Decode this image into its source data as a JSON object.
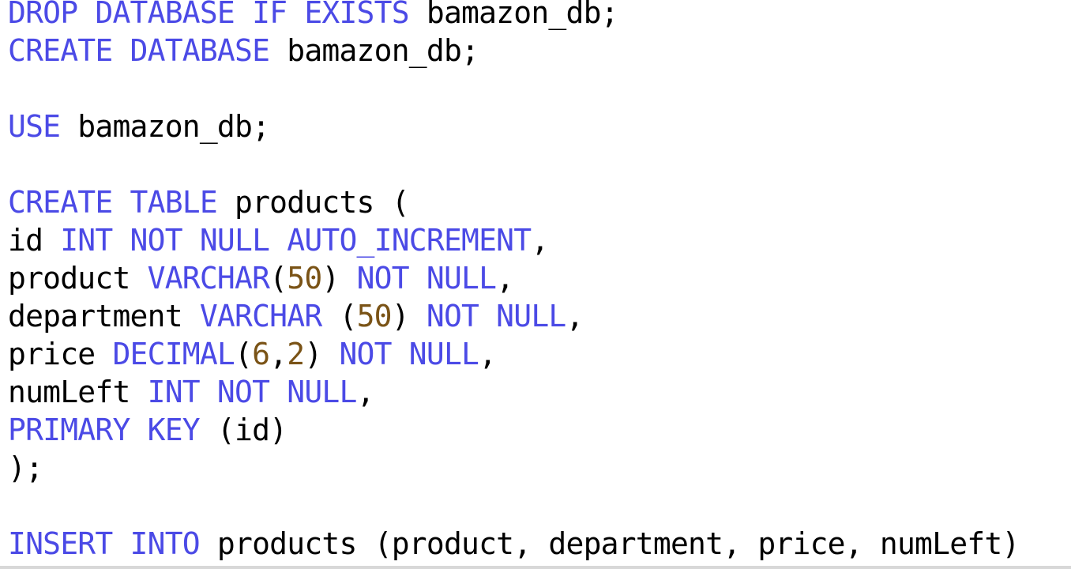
{
  "editor": {
    "colors": {
      "keyword": "#4b4ae6",
      "number": "#7a5316",
      "text": "#000000",
      "background": "#ffffff"
    },
    "lines": [
      [
        {
          "t": "DROP DATABASE IF EXISTS",
          "k": "kw"
        },
        {
          "t": " bamazon_db;",
          "k": "plain"
        }
      ],
      [
        {
          "t": "CREATE DATABASE",
          "k": "kw"
        },
        {
          "t": " bamazon_db;",
          "k": "plain"
        }
      ],
      [],
      [
        {
          "t": "USE",
          "k": "kw"
        },
        {
          "t": " bamazon_db;",
          "k": "plain"
        }
      ],
      [],
      [
        {
          "t": "CREATE TABLE",
          "k": "kw"
        },
        {
          "t": " products (",
          "k": "plain"
        }
      ],
      [
        {
          "t": "id ",
          "k": "plain"
        },
        {
          "t": "INT NOT NULL AUTO_INCREMENT",
          "k": "kw"
        },
        {
          "t": ",",
          "k": "plain"
        }
      ],
      [
        {
          "t": "product ",
          "k": "plain"
        },
        {
          "t": "VARCHAR",
          "k": "kw"
        },
        {
          "t": "(",
          "k": "plain"
        },
        {
          "t": "50",
          "k": "num"
        },
        {
          "t": ") ",
          "k": "plain"
        },
        {
          "t": "NOT NULL",
          "k": "kw"
        },
        {
          "t": ",",
          "k": "plain"
        }
      ],
      [
        {
          "t": "department ",
          "k": "plain"
        },
        {
          "t": "VARCHAR",
          "k": "kw"
        },
        {
          "t": " (",
          "k": "plain"
        },
        {
          "t": "50",
          "k": "num"
        },
        {
          "t": ") ",
          "k": "plain"
        },
        {
          "t": "NOT NULL",
          "k": "kw"
        },
        {
          "t": ",",
          "k": "plain"
        }
      ],
      [
        {
          "t": "price ",
          "k": "plain"
        },
        {
          "t": "DECIMAL",
          "k": "kw"
        },
        {
          "t": "(",
          "k": "plain"
        },
        {
          "t": "6",
          "k": "num"
        },
        {
          "t": ",",
          "k": "plain"
        },
        {
          "t": "2",
          "k": "num"
        },
        {
          "t": ") ",
          "k": "plain"
        },
        {
          "t": "NOT NULL",
          "k": "kw"
        },
        {
          "t": ",",
          "k": "plain"
        }
      ],
      [
        {
          "t": "numLeft ",
          "k": "plain"
        },
        {
          "t": "INT NOT NULL",
          "k": "kw"
        },
        {
          "t": ",",
          "k": "plain"
        }
      ],
      [
        {
          "t": "PRIMARY KEY",
          "k": "kw"
        },
        {
          "t": " (id)",
          "k": "plain"
        }
      ],
      [
        {
          "t": ");",
          "k": "plain"
        }
      ],
      [],
      [
        {
          "t": "INSERT INTO",
          "k": "kw"
        },
        {
          "t": " products (product, department, price, numLeft)",
          "k": "plain"
        }
      ]
    ]
  }
}
